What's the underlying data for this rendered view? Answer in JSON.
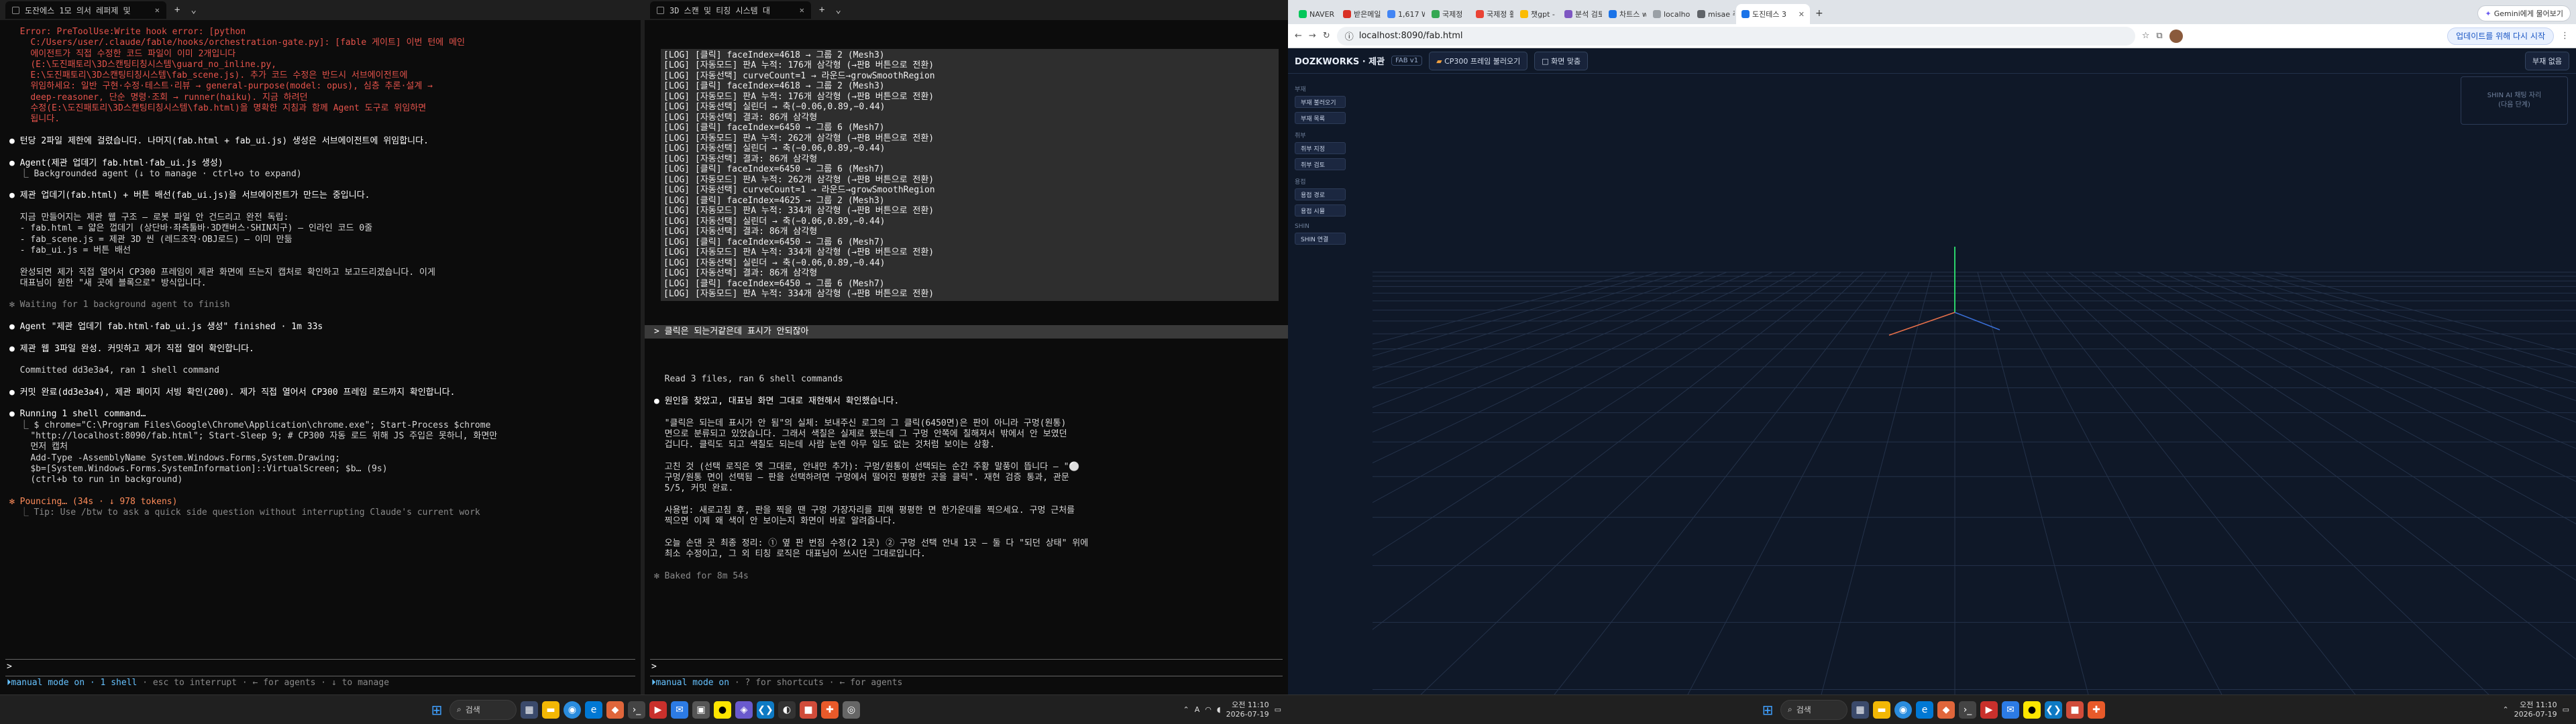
{
  "left_terminal": {
    "tab_title": "도잔에스 1모 의서 레퍼제 및",
    "lines": [
      {
        "c": "red",
        "t": "  Error: PreToolUse:Write hook error: [python"
      },
      {
        "c": "red",
        "t": "    C:/Users/user/.claude/fable/hooks/orchestration-gate.py]: [fable 게이트] 이번 턴에 메인"
      },
      {
        "c": "red",
        "t": "    에이전트가 직접 수정한 코드 파일이 이미 2개입니다"
      },
      {
        "c": "red",
        "t": "    (E:\\도진패토리\\3D스캔팅티칭시스템\\guard_no_inline.py,"
      },
      {
        "c": "red",
        "t": "    E:\\도진패토리\\3D스캔팅티칭시스템\\fab_scene.js). 추가 코드 수정은 반드시 서브에이전트에"
      },
      {
        "c": "red",
        "t": "    위임하세요: 일반 구현·수정·테스트·리뷰 → general-purpose(model: opus), 심층 추론·설계 →"
      },
      {
        "c": "red",
        "t": "    deep-reasoner, 단순 명령·조회 → runner(haiku). 지금 하려던"
      },
      {
        "c": "red",
        "t": "    수정(E:\\도진패토리\\3D스캔팅티칭시스템\\fab.html)을 명확한 지침과 함께 Agent 도구로 위임하면"
      },
      {
        "c": "red",
        "t": "    됩니다."
      },
      {
        "c": "",
        "t": ""
      },
      {
        "c": "white",
        "t": "● 턴당 2파일 제한에 걸렸습니다. 나머지(fab.html + fab_ui.js) 생성은 서브에이전트에 위임합니다."
      },
      {
        "c": "",
        "t": ""
      },
      {
        "c": "white",
        "t": "● Agent(제관 업데기 fab.html·fab_ui.js 생성)"
      },
      {
        "c": "",
        "t": "  ⎿ Backgrounded agent (↓ to manage · ctrl+o to expand)"
      },
      {
        "c": "",
        "t": ""
      },
      {
        "c": "white",
        "t": "● 제관 업데기(fab.html) + 버튼 배선(fab_ui.js)을 서브에이전트가 만드는 중입니다."
      },
      {
        "c": "",
        "t": ""
      },
      {
        "c": "",
        "t": "  지금 만들어지는 제관 웹 구조 — 로봇 파일 안 건드리고 완전 독립:"
      },
      {
        "c": "",
        "t": "  - fab.html = 얇은 껍데기 (상단바·좌측툴바·3D캔버스·SHIN치구) — 인라인 코드 0줄"
      },
      {
        "c": "",
        "t": "  - fab_scene.js = 제관 3D 씬 (레드조작·OBJ로드) — 이미 만듦"
      },
      {
        "c": "",
        "t": "  - fab_ui.js = 버튼 배선"
      },
      {
        "c": "",
        "t": ""
      },
      {
        "c": "",
        "t": "  완성되면 제가 직접 열어서 CP300 프레임이 제관 화면에 뜨는지 캡처로 확인하고 보고드리겠습니다. 이게"
      },
      {
        "c": "",
        "t": "  대표님이 원한 \"새 곳에 블록으로\" 방식입니다."
      },
      {
        "c": "",
        "t": ""
      },
      {
        "c": "gray",
        "t": "✻ Waiting for 1 background agent to finish"
      },
      {
        "c": "",
        "t": ""
      },
      {
        "c": "white",
        "t": "● Agent \"제관 업데기 fab.html·fab_ui.js 생성\" finished · 1m 33s"
      },
      {
        "c": "",
        "t": ""
      },
      {
        "c": "white",
        "t": "● 제관 웹 3파일 완성. 커밋하고 제가 직접 열어 확인합니다."
      },
      {
        "c": "",
        "t": ""
      },
      {
        "c": "",
        "t": "  Committed dd3e3a4, ran 1 shell command"
      },
      {
        "c": "",
        "t": ""
      },
      {
        "c": "white",
        "t": "● 커밋 완료(dd3e3a4), 제관 페이지 서빙 확인(200). 제가 직접 열어서 CP300 프레임 로드까지 확인합니다."
      },
      {
        "c": "",
        "t": ""
      },
      {
        "c": "white",
        "t": "● Running 1 shell command…"
      },
      {
        "c": "",
        "t": "  ⎿ $ chrome=\"C:\\Program Files\\Google\\Chrome\\Application\\chrome.exe\"; Start-Process $chrome"
      },
      {
        "c": "",
        "t": "    \"http://localhost:8090/fab.html\"; Start-Sleep 9; # CP300 자동 로드 위해 JS 주입은 못하니, 화면만"
      },
      {
        "c": "",
        "t": "    먼저 캡처"
      },
      {
        "c": "",
        "t": "    Add-Type -AssemblyName System.Windows.Forms,System.Drawing;"
      },
      {
        "c": "",
        "t": "    $b=[System.Windows.Forms.SystemInformation]::VirtualScreen; $b… (9s)"
      },
      {
        "c": "",
        "t": "    (ctrl+b to run in background)"
      },
      {
        "c": "",
        "t": ""
      },
      {
        "c": "orange",
        "t": "✻ Pouncing… (34s · ↓ 978 tokens)"
      },
      {
        "c": "gray",
        "t": "  ⎿ Tip: Use /btw to ask a quick side question without interrupting Claude's current work"
      }
    ],
    "prompt": ">",
    "status_hl": "⏵manual mode on",
    "status_shell": "· 1 shell",
    "status_rest": "· esc to interrupt · ← for agents · ↓ to manage"
  },
  "right_terminal": {
    "tab_title": "3D 스캔 및 티칭 시스템 대",
    "log_lines": [
      "[LOG] [클릭] faceIndex=4618 → 그룹 2 (Mesh3)",
      "[LOG] [자동모드] 판A 누적: 176개 삼각형 (→판B 버튼으로 전환)",
      "[LOG] [자동선택] curveCount=1 → 라운드→growSmoothRegion",
      "[LOG] [클릭] faceIndex=4618 → 그룹 2 (Mesh3)",
      "[LOG] [자동모드] 판A 누적: 176개 삼각형 (→판B 버튼으로 전환)",
      "[LOG] [자동선택] 실린더 → 축(−0.06,0.89,−0.44)",
      "[LOG] [자동선택] 결과: 86개 삼각형",
      "[LOG] [클릭] faceIndex=6450 → 그룹 6 (Mesh7)",
      "[LOG] [자동모드] 판A 누적: 262개 삼각형 (→판B 버튼으로 전환)",
      "[LOG] [자동선택] 실린더 → 축(−0.06,0.89,−0.44)",
      "[LOG] [자동선택] 결과: 86개 삼각형",
      "[LOG] [클릭] faceIndex=6450 → 그룹 6 (Mesh7)",
      "[LOG] [자동모드] 판A 누적: 262개 삼각형 (→판B 버튼으로 전환)",
      "[LOG] [자동선택] curveCount=1 → 라운드→growSmoothRegion",
      "[LOG] [클릭] faceIndex=4625 → 그룹 2 (Mesh3)",
      "[LOG] [자동모드] 판A 누적: 334개 삼각형 (→판B 버튼으로 전환)",
      "[LOG] [자동선택] 실린더 → 축(−0.06,0.89,−0.44)",
      "[LOG] [자동선택] 결과: 86개 삼각형",
      "[LOG] [클릭] faceIndex=6450 → 그룹 6 (Mesh7)",
      "[LOG] [자동모드] 판A 누적: 334개 삼각형 (→판B 버튼으로 전환)",
      "[LOG] [자동선택] 실린더 → 축(−0.06,0.89,−0.44)",
      "[LOG] [자동선택] 결과: 86개 삼각형",
      "[LOG] [클릭] faceIndex=6450 → 그룹 6 (Mesh7)",
      "[LOG] [자동모드] 판A 누적: 334개 삼각형 (→판B 버튼으로 전환)"
    ],
    "user_message": "> 클릭은 되는거같은데 표시가 안되잖아",
    "lines": [
      {
        "c": "",
        "t": ""
      },
      {
        "c": "",
        "t": "  Read 3 files, ran 6 shell commands"
      },
      {
        "c": "",
        "t": ""
      },
      {
        "c": "white",
        "t": "● 원인을 찾았고, 대표님 화면 그대로 재현해서 확인했습니다."
      },
      {
        "c": "",
        "t": ""
      },
      {
        "c": "",
        "t": "  \"클릭은 되는데 표시가 안 됨\"의 실체: 보내주신 로그의 그 클릭(6450면)은 판이 아니라 구멍(원통)"
      },
      {
        "c": "",
        "t": "  면으로 분류되고 있었습니다. 그래서 색칠은 실제로 됐는데 그 구멍 안쪽에 칠해져서 밖에서 안 보였던"
      },
      {
        "c": "",
        "t": "  겁니다. 클릭도 되고 색칠도 되는데 사람 눈엔 아무 일도 없는 것처럼 보이는 상황."
      },
      {
        "c": "",
        "t": ""
      },
      {
        "c": "",
        "t": "  고친 것 (선택 로직은 옛 그대로, 안내만 추가): 구멍/원통이 선택되는 순간 주황 말풍이 뜹니다 — \"⚪"
      },
      {
        "c": "",
        "t": "  구멍/원통 면이 선택됨 — 판을 선택하려면 구멍에서 떨어진 평평한 곳을 클릭\". 재현 검증 통과, 관문"
      },
      {
        "c": "",
        "t": "  5/5, 커밋 완료."
      },
      {
        "c": "",
        "t": ""
      },
      {
        "c": "",
        "t": "  사용법: 새로고침 후, 판을 찍을 땐 구멍 가장자리를 피해 평평한 면 한가운데를 찍으세요. 구멍 근처를"
      },
      {
        "c": "",
        "t": "  찍으면 이제 왜 색이 안 보이는지 화면이 바로 알려줍니다."
      },
      {
        "c": "",
        "t": ""
      },
      {
        "c": "",
        "t": "  오늘 손댄 곳 최종 정리: ① 옆 판 번짐 수정(2 1곳) ② 구멍 선택 안내 1곳 — 둘 다 \"되던 상태\" 위에"
      },
      {
        "c": "",
        "t": "  최소 수정이고, 그 외 티칭 로직은 대표님이 쓰시던 그대로입니다."
      },
      {
        "c": "",
        "t": ""
      },
      {
        "c": "gray",
        "t": "✻ Baked for 8m 54s"
      }
    ],
    "prompt": ">",
    "status_hl": "⏵manual mode on",
    "status_rest": "· ? for shortcuts · ← for agents"
  },
  "taskbar": {
    "search_label": "검색",
    "time": "오전 11:10",
    "date": "2026-07-19",
    "lang": "A"
  },
  "browser": {
    "tabs": [
      {
        "label": "NAVER",
        "color": "#03c75a"
      },
      {
        "label": "받은메일함",
        "color": "#d93025"
      },
      {
        "label": "1,617 W",
        "color": "#4285f4"
      },
      {
        "label": "국제정",
        "color": "#34a853"
      },
      {
        "label": "국제정 활동",
        "color": "#ea4335"
      },
      {
        "label": "챗gpt - 50",
        "color": "#fbbc04"
      },
      {
        "label": "분석 검토",
        "color": "#7e57c2"
      },
      {
        "label": "차트스 w",
        "color": "#1a73e8"
      },
      {
        "label": "localhost",
        "color": "#9aa0a6"
      },
      {
        "label": "misae 주",
        "color": "#5f6368"
      }
    ],
    "active_tab": "도진테스 3",
    "gemini_label": "Gemini에게 물어보기",
    "url": "localhost:8090/fab.html",
    "update_label": "업데이트를 위해 다시 시작"
  },
  "fab_app": {
    "brand": "DOZKWORKS · 제관",
    "version": "FAB v1",
    "load_button": "CP300 프레임 불러오기",
    "reset_button": "화면 맞춤",
    "right_button": "부재 없음",
    "groups": [
      {
        "title": "부재",
        "items": [
          "부재 불러오기",
          "부재 목록"
        ]
      },
      {
        "title": "취부",
        "items": [
          "취부 지정",
          "취부 검토"
        ]
      },
      {
        "title": "용접",
        "items": [
          "용접 경로",
          "용접 시뮬"
        ]
      },
      {
        "title": "SHIN",
        "items": [
          "SHIN 연결"
        ]
      }
    ],
    "info_line1": "SHIN AI 채팅 자리",
    "info_line2": "(다음 단계)"
  }
}
